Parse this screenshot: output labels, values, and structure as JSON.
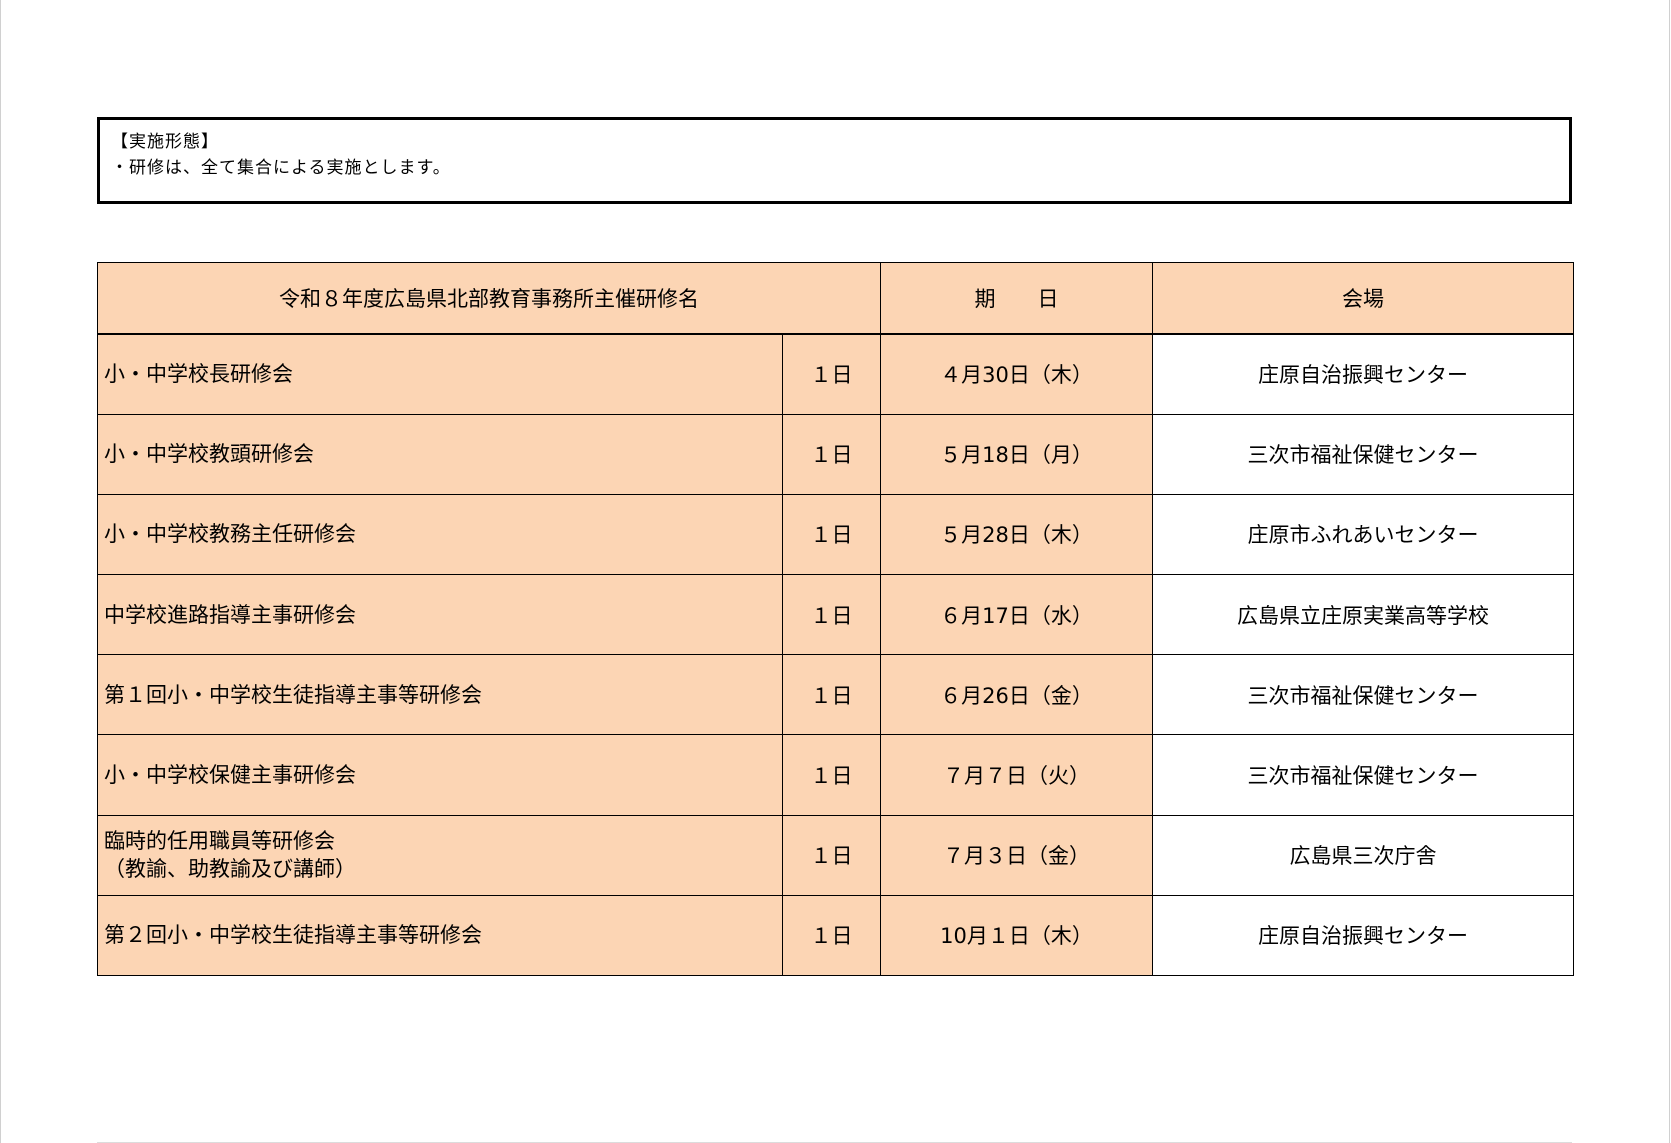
{
  "note": {
    "heading": "【実施形態】",
    "body": "・研修は、全て集合による実施とします。"
  },
  "table": {
    "headers": {
      "title": "令和８年度広島県北部教育事務所主催研修名",
      "date": "期　　日",
      "venue": "会場"
    },
    "rows": [
      {
        "name": "小・中学校長研修会",
        "name2": "",
        "days": "１日",
        "date": "４月30日（木）",
        "venue": "庄原自治振興センター"
      },
      {
        "name": "小・中学校教頭研修会",
        "name2": "",
        "days": "１日",
        "date": "５月18日（月）",
        "venue": "三次市福祉保健センター"
      },
      {
        "name": "小・中学校教務主任研修会",
        "name2": "",
        "days": "１日",
        "date": "５月28日（木）",
        "venue": "庄原市ふれあいセンター"
      },
      {
        "name": "中学校進路指導主事研修会",
        "name2": "",
        "days": "１日",
        "date": "６月17日（水）",
        "venue": "広島県立庄原実業高等学校"
      },
      {
        "name": "第１回小・中学校生徒指導主事等研修会",
        "name2": "",
        "days": "１日",
        "date": "６月26日（金）",
        "venue": "三次市福祉保健センター"
      },
      {
        "name": "小・中学校保健主事研修会",
        "name2": "",
        "days": "１日",
        "date": "７月７日（火）",
        "venue": "三次市福祉保健センター"
      },
      {
        "name": "臨時的任用職員等研修会",
        "name2": "（教諭、助教諭及び講師）",
        "days": "１日",
        "date": "７月３日（金）",
        "venue": "広島県三次庁舎"
      },
      {
        "name": "第２回小・中学校生徒指導主事等研修会",
        "name2": "",
        "days": "１日",
        "date": "10月１日（木）",
        "venue": "庄原自治振興センター"
      }
    ]
  },
  "colors": {
    "cell_fill": "#fcd5b4",
    "venue_fill": "#ffffff",
    "border": "#000000"
  }
}
